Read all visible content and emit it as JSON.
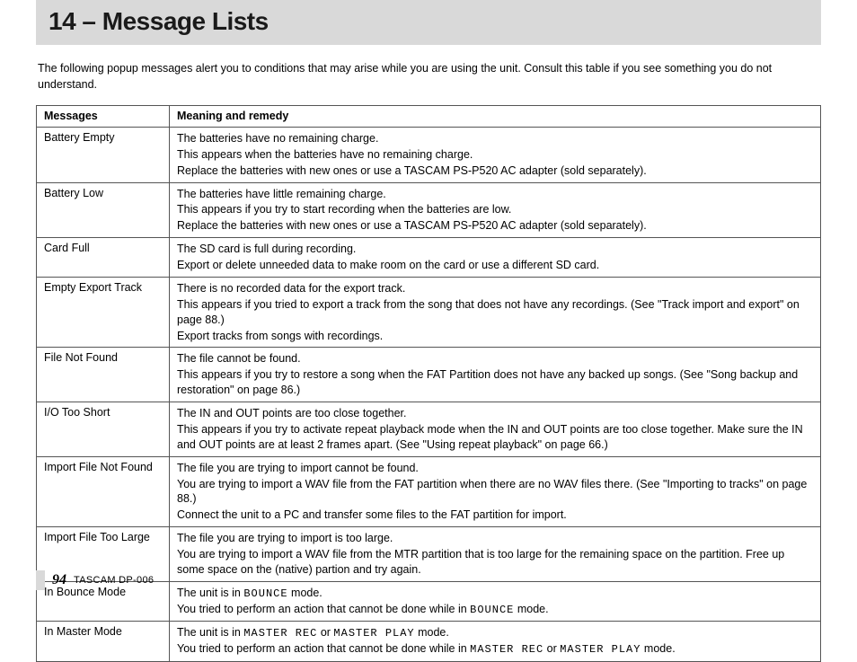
{
  "header": {
    "title": "14 – Message Lists"
  },
  "intro": "The following popup messages alert you to conditions that may arise while you are using the unit. Consult this table if you see something you do not understand.",
  "table": {
    "headers": {
      "col1": "Messages",
      "col2": "Meaning and remedy"
    },
    "rows": [
      {
        "msg": "Battery Empty",
        "lines": [
          "The batteries have no remaining charge.",
          "This appears when the batteries have no remaining charge.",
          "Replace the batteries with new ones or use a TASCAM PS-P520 AC adapter (sold separately)."
        ]
      },
      {
        "msg": "Battery Low",
        "lines": [
          "The batteries have little remaining charge.",
          "This appears if you try to start recording when the batteries are low.",
          "Replace the batteries with new ones or use a TASCAM PS-P520 AC adapter (sold separately)."
        ]
      },
      {
        "msg": "Card Full",
        "lines": [
          "The SD card is full during recording.",
          "Export or delete unneeded data to make room on the card or use a different SD card."
        ]
      },
      {
        "msg": "Empty Export Track",
        "lines": [
          "There is no recorded data for the export track.",
          "This appears if you tried to export a track from the song that does not have any recordings. (See \"Track import and export\" on page 88.)",
          "Export tracks from songs with recordings."
        ]
      },
      {
        "msg": "File Not Found",
        "lines": [
          "The file cannot be found.",
          "This appears if you try to restore a song when the FAT Partition does not have any backed up songs. (See \"Song backup and restoration\" on page 86.)"
        ]
      },
      {
        "msg": "I/O Too Short",
        "lines": [
          "The IN and OUT points are too close together.",
          "This appears if you try to activate repeat playback mode when the IN and OUT points are too close together. Make sure the IN and OUT points are at least 2 frames apart. (See \"Using repeat playback\" on page 66.)"
        ]
      },
      {
        "msg": "Import File Not Found",
        "lines": [
          "The file you are trying to import cannot be found.",
          "You are trying to import a WAV file from the FAT partition when there are no WAV files there. (See \"Importing to tracks\" on page 88.)",
          "Connect the unit to a PC and transfer some files to the FAT partition for import."
        ]
      },
      {
        "msg": "Import File Too Large",
        "lines": [
          "The file you are trying to import is too large.",
          "You are trying to import a WAV file from the MTR partition that is too large for the remaining space on the partition. Free up some space on the (native) partion and try again."
        ]
      },
      {
        "msg": "In Bounce Mode",
        "html_lines": [
          [
            {
              "t": "The unit is in "
            },
            {
              "t": "BOUNCE",
              "c": true
            },
            {
              "t": " mode."
            }
          ],
          [
            {
              "t": "You tried to perform an action that cannot be done while in "
            },
            {
              "t": "BOUNCE",
              "c": true
            },
            {
              "t": " mode."
            }
          ]
        ]
      },
      {
        "msg": "In Master Mode",
        "html_lines": [
          [
            {
              "t": "The unit is in "
            },
            {
              "t": "MASTER REC",
              "c": true
            },
            {
              "t": " or "
            },
            {
              "t": "MASTER PLAY",
              "c": true
            },
            {
              "t": " mode."
            }
          ],
          [
            {
              "t": "You tried to perform an action that cannot be done while in "
            },
            {
              "t": "MASTER REC",
              "c": true
            },
            {
              "t": " or "
            },
            {
              "t": "MASTER PLAY",
              "c": true
            },
            {
              "t": " mode."
            }
          ]
        ]
      }
    ]
  },
  "footer": {
    "page": "94",
    "model": "TASCAM  DP-006"
  }
}
